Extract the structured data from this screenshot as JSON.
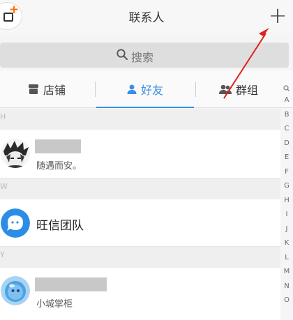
{
  "header": {
    "title": "联系人",
    "add_label": "+",
    "app_icon": "app-badge-icon"
  },
  "search": {
    "placeholder": "搜索"
  },
  "tabs": [
    {
      "label": "店铺",
      "icon": "store-icon"
    },
    {
      "label": "好友",
      "icon": "person-icon",
      "active": true
    },
    {
      "label": "群组",
      "icon": "group-icon"
    }
  ],
  "sections": [
    {
      "letter": "H"
    },
    {
      "letter": "W"
    },
    {
      "letter": "Y"
    }
  ],
  "contacts": [
    {
      "subtitle": "随遇而安。",
      "name_blurred": true,
      "avatar": "anime-avatar"
    },
    {
      "name": "旺信团队",
      "avatar": "wangxin-avatar"
    },
    {
      "subtitle": "小城掌柜",
      "name_blurred": true,
      "avatar": "bubble-avatar"
    }
  ],
  "index_letters": [
    "A",
    "B",
    "C",
    "D",
    "E",
    "F",
    "G",
    "H",
    "I",
    "J",
    "K",
    "L",
    "M",
    "N",
    "O"
  ],
  "colors": {
    "accent": "#3a8ee6",
    "arrow": "#e0201c",
    "badge_plus": "#ff6a00"
  }
}
